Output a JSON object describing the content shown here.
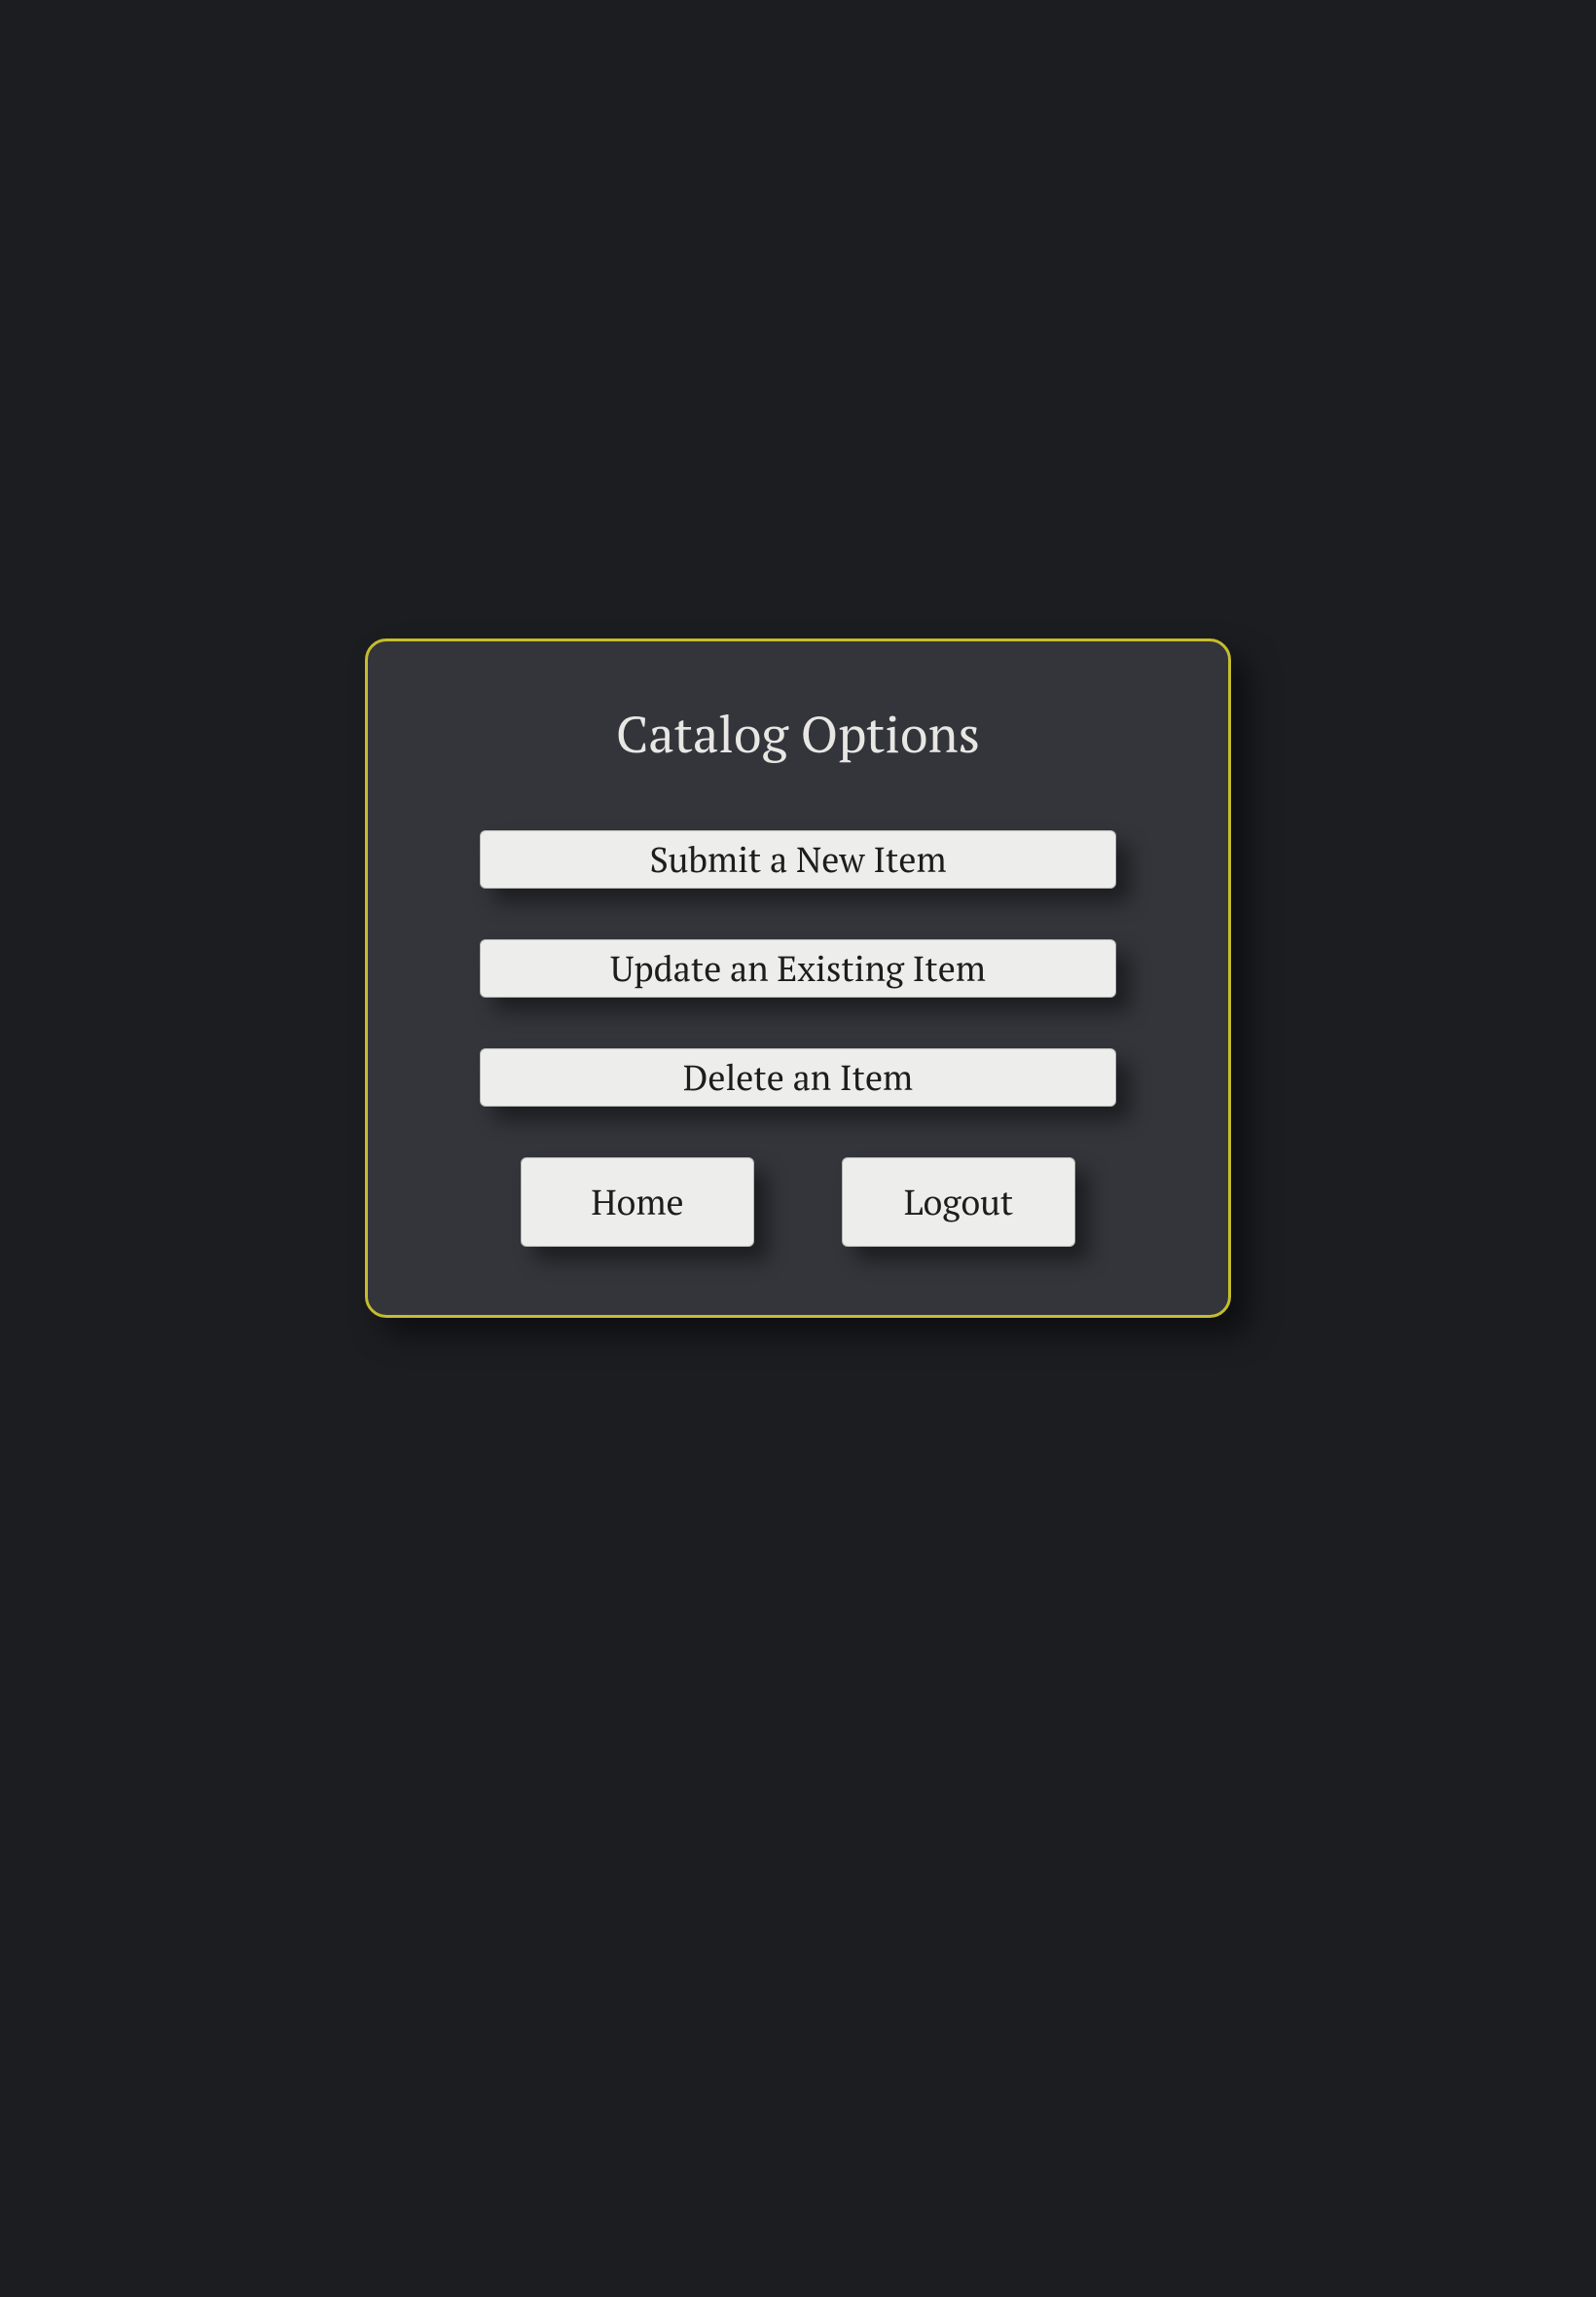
{
  "dialog": {
    "title": "Catalog Options",
    "options": [
      {
        "label": "Submit a New Item"
      },
      {
        "label": "Update an Existing Item"
      },
      {
        "label": "Delete an Item"
      }
    ],
    "nav": {
      "home_label": "Home",
      "logout_label": "Logout"
    }
  }
}
